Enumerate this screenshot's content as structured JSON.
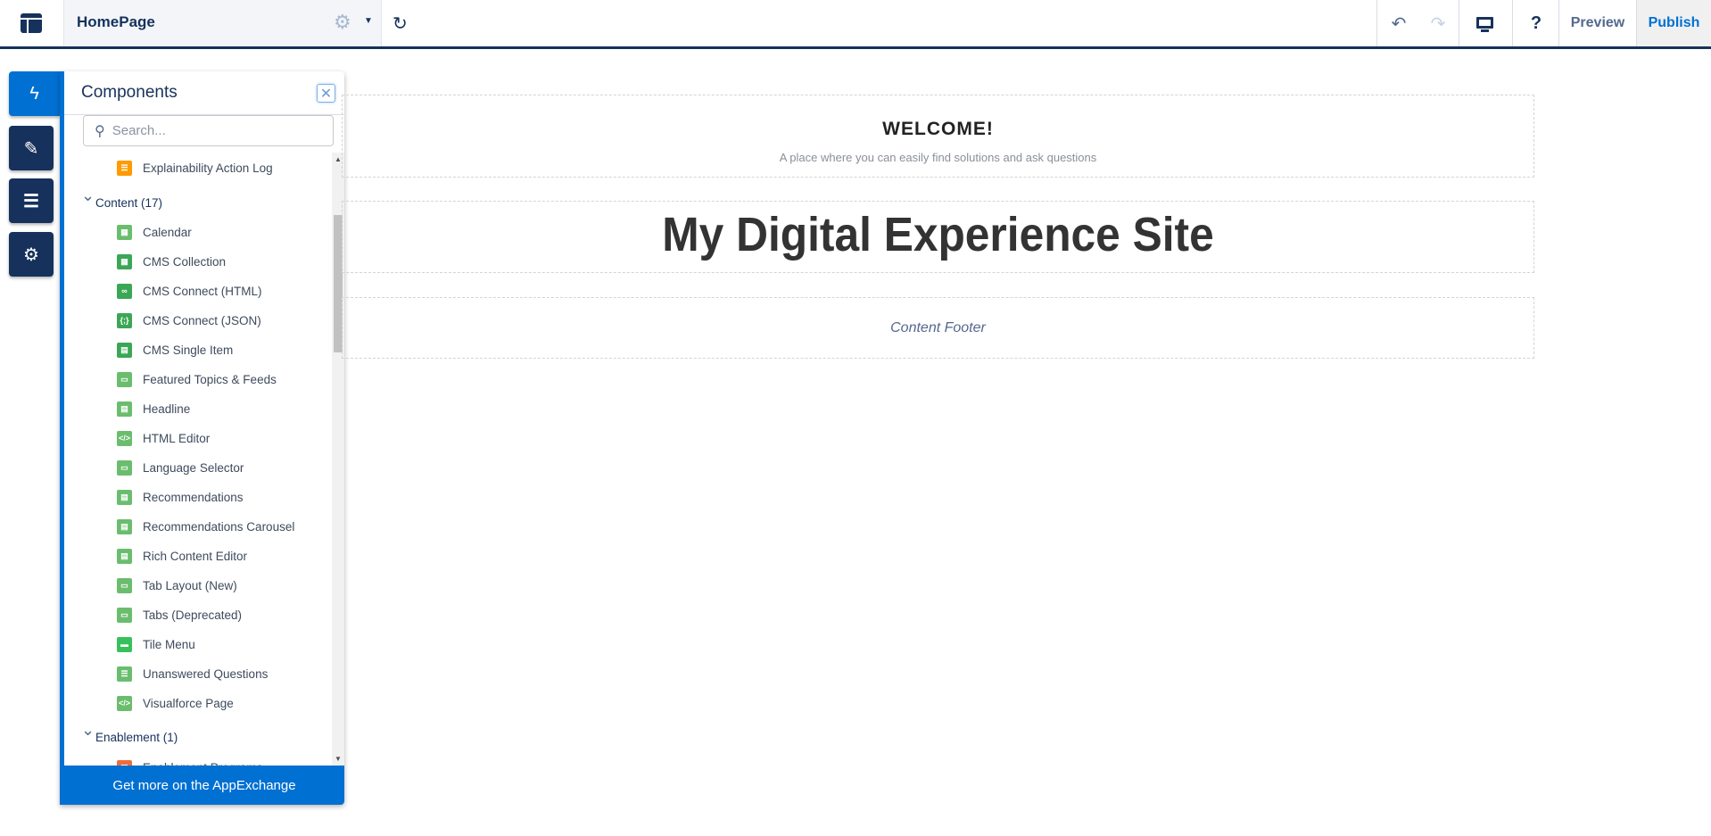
{
  "topbar": {
    "page_name": "HomePage",
    "preview_label": "Preview",
    "publish_label": "Publish"
  },
  "icons": {
    "layout": "layout-icon",
    "settings": "gear-icon",
    "dropdown": "caret-down-icon",
    "refresh": "refresh-icon",
    "undo": "undo-icon",
    "redo": "redo-icon",
    "device": "desktop-icon",
    "help": "question-icon"
  },
  "rail": [
    {
      "name": "components",
      "icon": "lightning-icon",
      "active": true
    },
    {
      "name": "theme",
      "icon": "brush-icon"
    },
    {
      "name": "page-structure",
      "icon": "list-icon"
    },
    {
      "name": "settings",
      "icon": "gear-icon"
    }
  ],
  "panel": {
    "title": "Components",
    "search_placeholder": "Search...",
    "above_item": {
      "label": "Explainability Action Log",
      "color": "#ff9a00"
    },
    "groups": [
      {
        "label": "Content (17)",
        "items": [
          {
            "label": "Calendar",
            "color": "#6bbd6e",
            "glyph": "▦"
          },
          {
            "label": "CMS Collection",
            "color": "#3ba755",
            "glyph": "▦"
          },
          {
            "label": "CMS Connect (HTML)",
            "color": "#3ba755",
            "glyph": "∞"
          },
          {
            "label": "CMS Connect (JSON)",
            "color": "#3ba755",
            "glyph": "{;}"
          },
          {
            "label": "CMS Single Item",
            "color": "#3ba755",
            "glyph": "▤"
          },
          {
            "label": "Featured Topics & Feeds",
            "color": "#6bbd6e",
            "glyph": "▭"
          },
          {
            "label": "Headline",
            "color": "#6bbd6e",
            "glyph": "▤"
          },
          {
            "label": "HTML Editor",
            "color": "#6bbd6e",
            "glyph": "</>"
          },
          {
            "label": "Language Selector",
            "color": "#6bbd6e",
            "glyph": "▭"
          },
          {
            "label": "Recommendations",
            "color": "#6bbd6e",
            "glyph": "▤"
          },
          {
            "label": "Recommendations Carousel",
            "color": "#6bbd6e",
            "glyph": "▤"
          },
          {
            "label": "Rich Content Editor",
            "color": "#6bbd6e",
            "glyph": "▤"
          },
          {
            "label": "Tab Layout (New)",
            "color": "#6bbd6e",
            "glyph": "▭"
          },
          {
            "label": "Tabs (Deprecated)",
            "color": "#6bbd6e",
            "glyph": "▭"
          },
          {
            "label": "Tile Menu",
            "color": "#38c15a",
            "glyph": "▬"
          },
          {
            "label": "Unanswered Questions",
            "color": "#6bbd6e",
            "glyph": "☰"
          },
          {
            "label": "Visualforce Page",
            "color": "#6bbd6e",
            "glyph": "</>"
          }
        ]
      },
      {
        "label": "Enablement (1)",
        "items": [
          {
            "label": "Enablement Programs",
            "color": "#f26b3a",
            "glyph": "▤"
          }
        ]
      }
    ],
    "footer_label": "Get more on the AppExchange"
  },
  "canvas": {
    "welcome": "WELCOME!",
    "subtitle": "A place where you can easily find solutions and ask questions",
    "site_title": "My Digital Experience Site",
    "footer": "Content Footer"
  },
  "colors": {
    "brand_navy": "#16325c",
    "accent_blue": "#0070d2"
  }
}
